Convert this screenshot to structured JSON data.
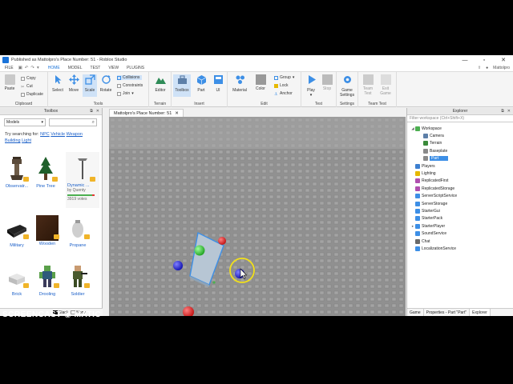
{
  "window": {
    "title": "Published as Mattolpro's Place Number: 51 - Roblox Studio",
    "minimize": "—",
    "maximize": "▫",
    "close": "✕"
  },
  "menubar": {
    "file": "FILE",
    "tabs": [
      {
        "label": "HOME",
        "active": true
      },
      {
        "label": "MODEL",
        "active": false
      },
      {
        "label": "TEST",
        "active": false
      },
      {
        "label": "VIEW",
        "active": false
      },
      {
        "label": "PLUGINS",
        "active": false
      }
    ],
    "user": "Mattolpro"
  },
  "ribbon": {
    "clipboard": {
      "label": "Clipboard",
      "paste": "Paste",
      "copy": "Copy",
      "cut": "Cut",
      "duplicate": "Duplicate"
    },
    "tools": {
      "label": "Tools",
      "select": "Select",
      "move": "Move",
      "scale": "Scale",
      "rotate": "Rotate",
      "collisions": "Collisions",
      "constraints": "Constraints",
      "join": "Join"
    },
    "terrain": {
      "label": "Terrain",
      "editor": "Editor"
    },
    "insert": {
      "label": "Insert",
      "toolbox": "Toolbox",
      "part": "Part",
      "ui": "UI"
    },
    "edit": {
      "label": "Edit",
      "material": "Material",
      "color": "Color",
      "group": "Group",
      "lock": "Lock",
      "anchor": "Anchor"
    },
    "test": {
      "label": "Test",
      "play": "Play",
      "stop": "Stop"
    },
    "settings": {
      "label": "Settings",
      "game_settings": "Game Settings"
    },
    "team_test": {
      "label": "Team Test",
      "team_test": "Team Test",
      "exit_game": "Exit Game"
    }
  },
  "toolbox": {
    "title": "Toolbox",
    "category": "Models",
    "try_prefix": "Try searching for:",
    "suggestions": [
      "NPC",
      "Vehicle",
      "Weapon",
      "Building",
      "Light"
    ],
    "items": [
      {
        "name": "Observatr..."
      },
      {
        "name": "Pine Tree"
      },
      {
        "name": "Dynamic ...",
        "creator": "by Quenty",
        "votes": "3919 votes"
      },
      {
        "name": "Military"
      },
      {
        "name": "Wooden"
      },
      {
        "name": "Propane"
      },
      {
        "name": "Brick"
      },
      {
        "name": "Drooling"
      },
      {
        "name": "Soldier"
      }
    ],
    "footer_black": "Black",
    "footer_none": "None"
  },
  "viewport": {
    "tab": "Mattolpro's Place Number: 51"
  },
  "explorer": {
    "title": "Explorer",
    "filter_placeholder": "Filter workspace (Ctrl+Shift+X)",
    "items": [
      {
        "label": "Workspace",
        "level": 0,
        "expanded": true,
        "color": "#4caf50"
      },
      {
        "label": "Camera",
        "level": 1,
        "color": "#5d7fa8"
      },
      {
        "label": "Terrain",
        "level": 1,
        "color": "#3a8a3a"
      },
      {
        "label": "Baseplate",
        "level": 1,
        "color": "#8a8a8a"
      },
      {
        "label": "Part",
        "level": 1,
        "selected": true,
        "color": "#8a8a8a"
      },
      {
        "label": "Players",
        "level": 0,
        "color": "#3d7fd0"
      },
      {
        "label": "Lighting",
        "level": 0,
        "color": "#e6b800"
      },
      {
        "label": "ReplicatedFirst",
        "level": 0,
        "color": "#b04fb0"
      },
      {
        "label": "ReplicatedStorage",
        "level": 0,
        "color": "#b04fb0"
      },
      {
        "label": "ServerScriptService",
        "level": 0,
        "color": "#3d8fe6"
      },
      {
        "label": "ServerStorage",
        "level": 0,
        "color": "#3d8fe6"
      },
      {
        "label": "StarterGui",
        "level": 0,
        "color": "#3d8fe6"
      },
      {
        "label": "StarterPack",
        "level": 0,
        "color": "#3d8fe6"
      },
      {
        "label": "StarterPlayer",
        "level": 0,
        "color": "#3d8fe6",
        "collapsed": true
      },
      {
        "label": "SoundService",
        "level": 0,
        "color": "#3d8fe6"
      },
      {
        "label": "Chat",
        "level": 0,
        "color": "#6a6a6a"
      },
      {
        "label": "LocalizationService",
        "level": 0,
        "color": "#3d8fe6"
      }
    ],
    "tabs": [
      {
        "label": "Game",
        "active": false
      },
      {
        "label": "Properties - Part \"Part\"",
        "active": false
      },
      {
        "label": "Explorer",
        "active": true
      }
    ]
  },
  "watermark": {
    "recorded": "RECORDED WITH",
    "brand": "SCREENCAST ◉ MATIC"
  }
}
